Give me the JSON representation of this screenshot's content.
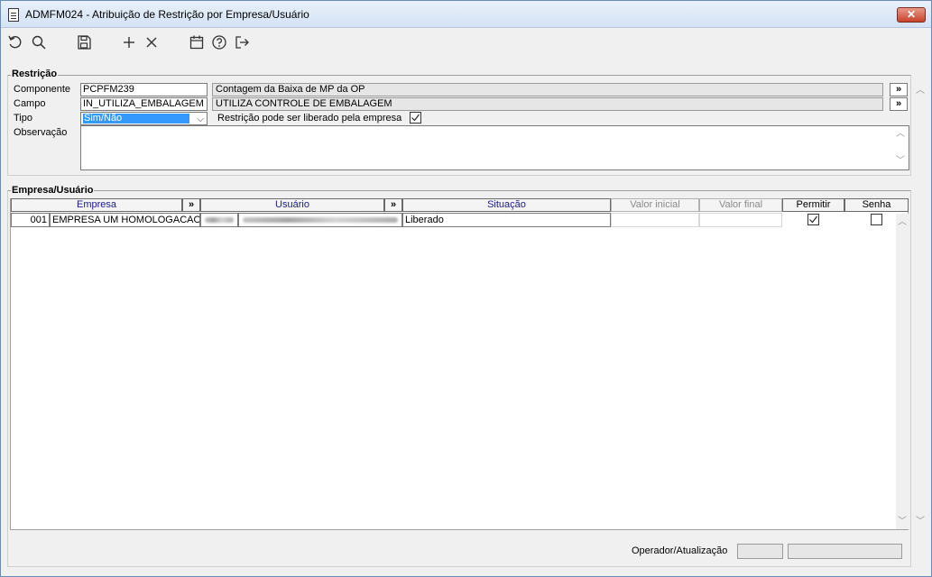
{
  "window": {
    "title": "ADMFM024 - Atribuição de Restrição por Empresa/Usuário",
    "close_label": "✕"
  },
  "toolbar": {
    "icons": [
      "undo-icon",
      "search-icon",
      "save-icon",
      "add-icon",
      "delete-icon",
      "calendar-icon",
      "help-icon",
      "exit-icon"
    ]
  },
  "restricao": {
    "group_label": "Restrição",
    "componente_label": "Componente",
    "componente_code": "PCPFM239",
    "componente_desc": "Contagem da Baixa de MP da OP",
    "campo_label": "Campo",
    "campo_code": "IN_UTILIZA_EMBALAGEM",
    "campo_desc": "UTILIZA CONTROLE DE EMBALAGEM",
    "tipo_label": "Tipo",
    "tipo_value": "Sim/Não",
    "liberado_label": "Restrição pode ser liberado pela empresa",
    "liberado_checked": true,
    "observacao_label": "Observação",
    "observacao_value": "",
    "lookup_label": "»"
  },
  "empresa_usuario": {
    "group_label": "Empresa/Usuário",
    "columns": {
      "empresa": "Empresa",
      "usuario": "Usuário",
      "situacao": "Situação",
      "valor_inicial": "Valor inicial",
      "valor_final": "Valor final",
      "permitir": "Permitir",
      "senha": "Senha",
      "arrow": "»"
    },
    "rows": [
      {
        "empresa_code": "001",
        "empresa_name": "EMPRESA UM HOMOLOGACAO",
        "usuario": "",
        "situacao": "Liberado",
        "valor_inicial": "",
        "valor_final": "",
        "permitir": true,
        "senha": false
      }
    ]
  },
  "footer": {
    "operador_label": "Operador/Atualização"
  }
}
